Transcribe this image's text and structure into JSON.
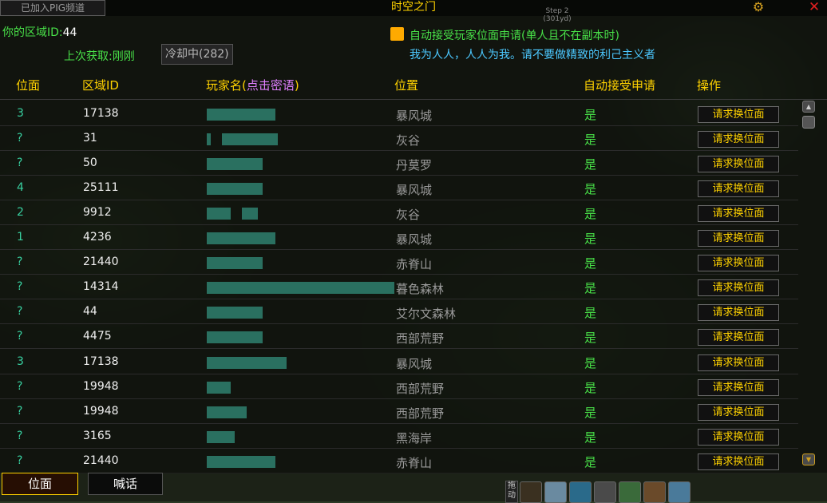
{
  "window": {
    "joined_tab": "已加入PIG频道",
    "title": "时空之门",
    "step_label": "Step 2",
    "step_distance": "(301yd)"
  },
  "info": {
    "zone_label": "你的区域ID:",
    "zone_value": "44",
    "last_fetch": "上次获取:刚刚",
    "cooldown": "冷却中(282)",
    "auto_accept_label": "自动接受玩家位面申请(单人且不在副本时)",
    "motto": "我为人人，人人为我。请不要做精致的利己主义者"
  },
  "columns": {
    "pos": "位面",
    "zone": "区域ID",
    "name_prefix": "玩家名(",
    "name_hint": "点击密语",
    "name_suffix": ")",
    "location": "位置",
    "auto": "自动接受申请",
    "action": "操作"
  },
  "rows": [
    {
      "pos": "3",
      "zone": "17138",
      "location": "暴风城",
      "auto": "是",
      "action": "请求换位面"
    },
    {
      "pos": "?",
      "zone": "31",
      "location": "灰谷",
      "auto": "是",
      "action": "请求换位面"
    },
    {
      "pos": "?",
      "zone": "50",
      "location": "丹莫罗",
      "auto": "是",
      "action": "请求换位面"
    },
    {
      "pos": "4",
      "zone": "25111",
      "location": "暴风城",
      "auto": "是",
      "action": "请求换位面"
    },
    {
      "pos": "2",
      "zone": "9912",
      "location": "灰谷",
      "auto": "是",
      "action": "请求换位面"
    },
    {
      "pos": "1",
      "zone": "4236",
      "location": "暴风城",
      "auto": "是",
      "action": "请求换位面"
    },
    {
      "pos": "?",
      "zone": "21440",
      "location": "赤脊山",
      "auto": "是",
      "action": "请求换位面"
    },
    {
      "pos": "?",
      "zone": "14314",
      "location": "暮色森林",
      "auto": "是",
      "action": "请求换位面"
    },
    {
      "pos": "?",
      "zone": "44",
      "location": "艾尔文森林",
      "auto": "是",
      "action": "请求换位面"
    },
    {
      "pos": "?",
      "zone": "4475",
      "location": "西部荒野",
      "auto": "是",
      "action": "请求换位面"
    },
    {
      "pos": "3",
      "zone": "17138",
      "location": "暴风城",
      "auto": "是",
      "action": "请求换位面"
    },
    {
      "pos": "?",
      "zone": "19948",
      "location": "西部荒野",
      "auto": "是",
      "action": "请求换位面"
    },
    {
      "pos": "?",
      "zone": "19948",
      "location": "西部荒野",
      "auto": "是",
      "action": "请求换位面"
    },
    {
      "pos": "?",
      "zone": "3165",
      "location": "黑海岸",
      "auto": "是",
      "action": "请求换位面"
    },
    {
      "pos": "?",
      "zone": "21440",
      "location": "赤脊山",
      "auto": "是",
      "action": "请求换位面"
    }
  ],
  "bottom": {
    "tab_pos": "位面",
    "tab_shout": "喊话",
    "drag_label": "拖动"
  },
  "colors": {
    "title_gold": "#ffd200",
    "green": "#48e048",
    "cyan": "#4cc8ff",
    "pos_teal": "#38d0a0",
    "checkbox": "#ffaa00"
  }
}
